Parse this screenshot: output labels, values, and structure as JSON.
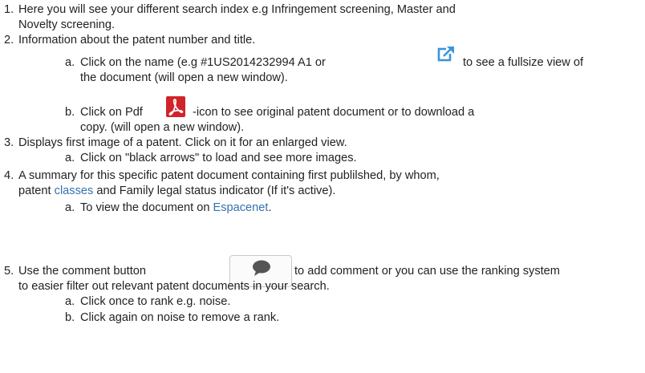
{
  "items": {
    "i1": {
      "num": "1.",
      "line1": "Here you will see your different search index e.g Infringement screening, Master and",
      "line2": "Novelty screening."
    },
    "i2": {
      "num": "2.",
      "text": "Information about the patent number and title."
    },
    "i2a": {
      "letter": "a.",
      "before": "Click on the name (e.g #1US2014232994 A1 or",
      "after": "to see a fullsize view of",
      "line2": "the document (will open a new window)."
    },
    "i2b": {
      "letter": "b.",
      "before": "Click on Pdf",
      "after": "-icon to see original patent document or to download a",
      "line2": "copy. (will open a new window)."
    },
    "i3": {
      "num": "3.",
      "text": "Displays first image of a patent. Click on it for an enlarged view."
    },
    "i3a": {
      "letter": "a.",
      "text": "Click on  \"black arrows\" to load and see more images."
    },
    "i4": {
      "num": "4.",
      "line1": "A summary for this specific patent document containing first publilshed, by whom,",
      "line2_before": "patent ",
      "line2_link": "classes",
      "line2_after": " and Family legal status indicator (If it's active)."
    },
    "i4a": {
      "letter": "a.",
      "before": "To view the document on ",
      "link": "Espacenet",
      "after": "."
    },
    "i5": {
      "num": "5.",
      "before": "Use the comment button",
      "after": "to add comment or you can use the ranking system",
      "line2": "to easier filter out relevant patent documents in your search."
    },
    "i5a": {
      "letter": "a.",
      "text": "Click once to rank e.g. noise."
    },
    "i5b": {
      "letter": "b.",
      "text": "Click again on noise to remove a rank."
    }
  },
  "icons": {
    "external_link": "external-link-icon",
    "pdf": "pdf-icon",
    "comment": "speech-bubble-icon"
  },
  "colors": {
    "link": "#3572b0",
    "text": "#222222",
    "external_icon": "#3b95dd",
    "pdf_icon": "#d1232b"
  }
}
